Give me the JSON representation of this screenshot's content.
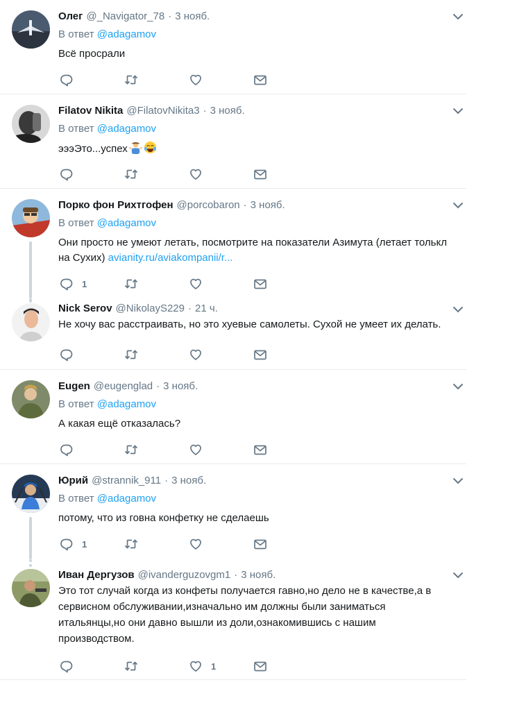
{
  "tweets": [
    {
      "name": "Олег",
      "handle": "@_Navigator_78",
      "dot": "·",
      "time": "3 нояб.",
      "reply_prefix": "В ответ",
      "reply_mention": "@adagamov",
      "text": "Всё просрали",
      "reply_count": "",
      "like_count": ""
    },
    {
      "name": "Filatov Nikita",
      "handle": "@FilatovNikita3",
      "dot": "·",
      "time": "3 нояб.",
      "reply_prefix": "В ответ",
      "reply_mention": "@adagamov",
      "text": "эээЭто...успех",
      "reply_count": "",
      "like_count": ""
    },
    {
      "name": "Порко фон Рихтгофен",
      "handle": "@porcobaron",
      "dot": "·",
      "time": "3 нояб.",
      "reply_prefix": "В ответ",
      "reply_mention": "@adagamov",
      "text": "Они просто не умеют летать, посмотрите на показатели Азимута (летает толькл на Сухих)",
      "link": "avianity.ru/aviakompanii/r...",
      "reply_count": "1",
      "like_count": ""
    },
    {
      "name": "Nick Serov",
      "handle": "@NikolayS229",
      "dot": "·",
      "time": "21 ч.",
      "text": "Не хочу вас расстраивать, но это хуевые самолеты. Сухой не умеет их делать.",
      "reply_count": "",
      "like_count": ""
    },
    {
      "name": "Eugen",
      "handle": "@eugenglad",
      "dot": "·",
      "time": "3 нояб.",
      "reply_prefix": "В ответ",
      "reply_mention": "@adagamov",
      "text": "А какая ещё отказалась?",
      "reply_count": "",
      "like_count": ""
    },
    {
      "name": "Юрий",
      "handle": "@strannik_911",
      "dot": "·",
      "time": "3 нояб.",
      "reply_prefix": "В ответ",
      "reply_mention": "@adagamov",
      "text": "потому, что из говна конфетку не сделаешь",
      "reply_count": "1",
      "like_count": ""
    },
    {
      "name": "Иван Дергузов",
      "handle": "@ivanderguzovgm1",
      "dot": "·",
      "time": "3 нояб.",
      "text": "Это тот случай когда из конфеты получается гавно,но дело не в качестве,а в сервисном обслуживании,изначально им должны были заниматься итальянцы,но они давно вышли из доли,ознакомившись с нашим производством.",
      "reply_count": "",
      "like_count": "1"
    }
  ],
  "icons": {
    "reply": "reply-icon",
    "retweet": "retweet-icon",
    "like": "heart-icon",
    "dm": "envelope-icon",
    "more": "chevron-down-icon"
  },
  "colors": {
    "link": "#1da1f2",
    "secondary": "#657786",
    "divider": "#e6ecf0",
    "thread": "#ccd6dd"
  }
}
